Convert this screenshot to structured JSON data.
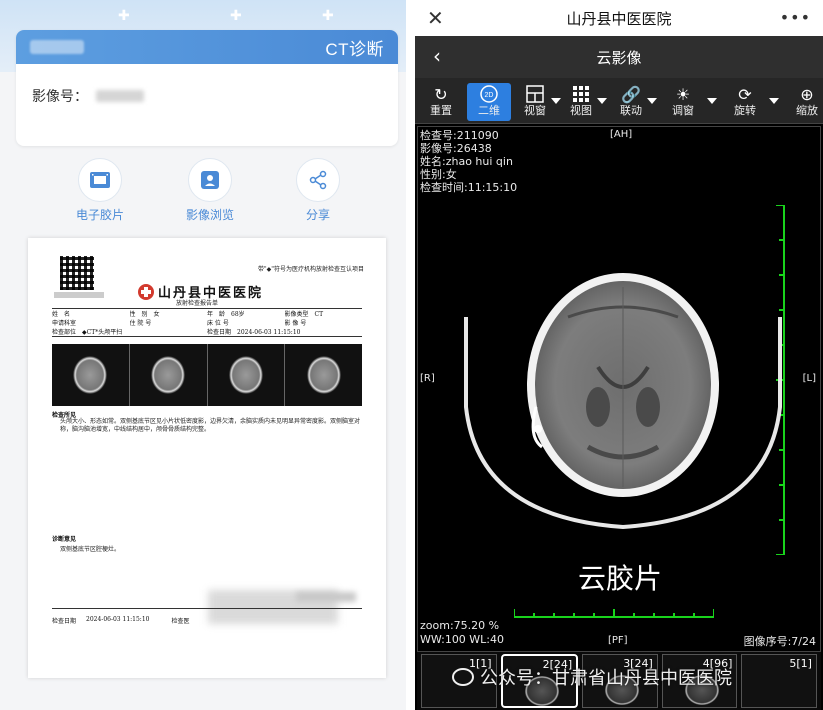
{
  "left": {
    "card": {
      "mode": "CT诊断",
      "image_label": "影像号："
    },
    "actions": [
      {
        "label": "电子胶片",
        "icon": "film-icon"
      },
      {
        "label": "影像浏览",
        "icon": "image-browse-icon"
      },
      {
        "label": "分享",
        "icon": "share-icon"
      }
    ],
    "report": {
      "notice": "带\"◆\"符号为医疗机构放射检查互认项目",
      "hospital": "山丹县中医医院",
      "subtitle": "放射检查报告单",
      "row1": [
        "姓　名",
        "性　别　女",
        "年　龄　68岁",
        "影像类型　CT"
      ],
      "row2": [
        "申请科室",
        "住 院 号",
        "床 位 号",
        "影 像 号"
      ],
      "row3": [
        "检查部位　◆CT*头颅平扫",
        "检查日期　2024-06-03 11:15:10"
      ],
      "findings_title": "检查所见",
      "findings_text": "头颅大小、形态如常。双侧基底节区见小片状低密度影，边界欠清，余脑实质内未见明显异常密度影。双侧脑室对称，脑沟脑池增宽，中线结构居中，颅骨骨质结构完整。",
      "diag_title": "诊断意见",
      "diag_text": "双侧基底节区腔梗灶。",
      "foot_date_label": "检查日期",
      "foot_date": "2024-06-03 11:15:10",
      "foot_doctor_label": "检查医"
    }
  },
  "right": {
    "topbar_title": "山丹县中医医院",
    "nav_title": "云影像",
    "tools": [
      {
        "label": "重置",
        "icon": "reset-icon"
      },
      {
        "label": "二维",
        "icon": "2d-icon"
      },
      {
        "label": "视窗",
        "icon": "window-layout-icon"
      },
      {
        "label": "视图",
        "icon": "grid-view-icon"
      },
      {
        "label": "联动",
        "icon": "link-icon"
      },
      {
        "label": "调窗",
        "icon": "brightness-icon"
      },
      {
        "label": "旋转",
        "icon": "rotate-icon"
      },
      {
        "label": "缩放",
        "icon": "zoom-icon"
      }
    ],
    "meta": {
      "exam_no": "检查号:211090",
      "image_no": "影像号:26438",
      "name": "姓名:zhao hui qin",
      "sex": "性别:女",
      "time": "检查时间:11:15:10"
    },
    "orient": {
      "top": "[AH]",
      "left": "[R]",
      "right": "[L]",
      "bottom": "[PF]"
    },
    "watermark": "云胶片",
    "zoom": "zoom:75.20 %",
    "window": "WW:100 WL:40",
    "image_seq": "图像序号:7/24",
    "series": [
      {
        "label": "1[1]"
      },
      {
        "label": "2[24]"
      },
      {
        "label": "3[24]"
      },
      {
        "label": "4[96]"
      },
      {
        "label": "5[1]"
      }
    ],
    "public_account": "公众号：甘肃省山丹县中医医院"
  }
}
